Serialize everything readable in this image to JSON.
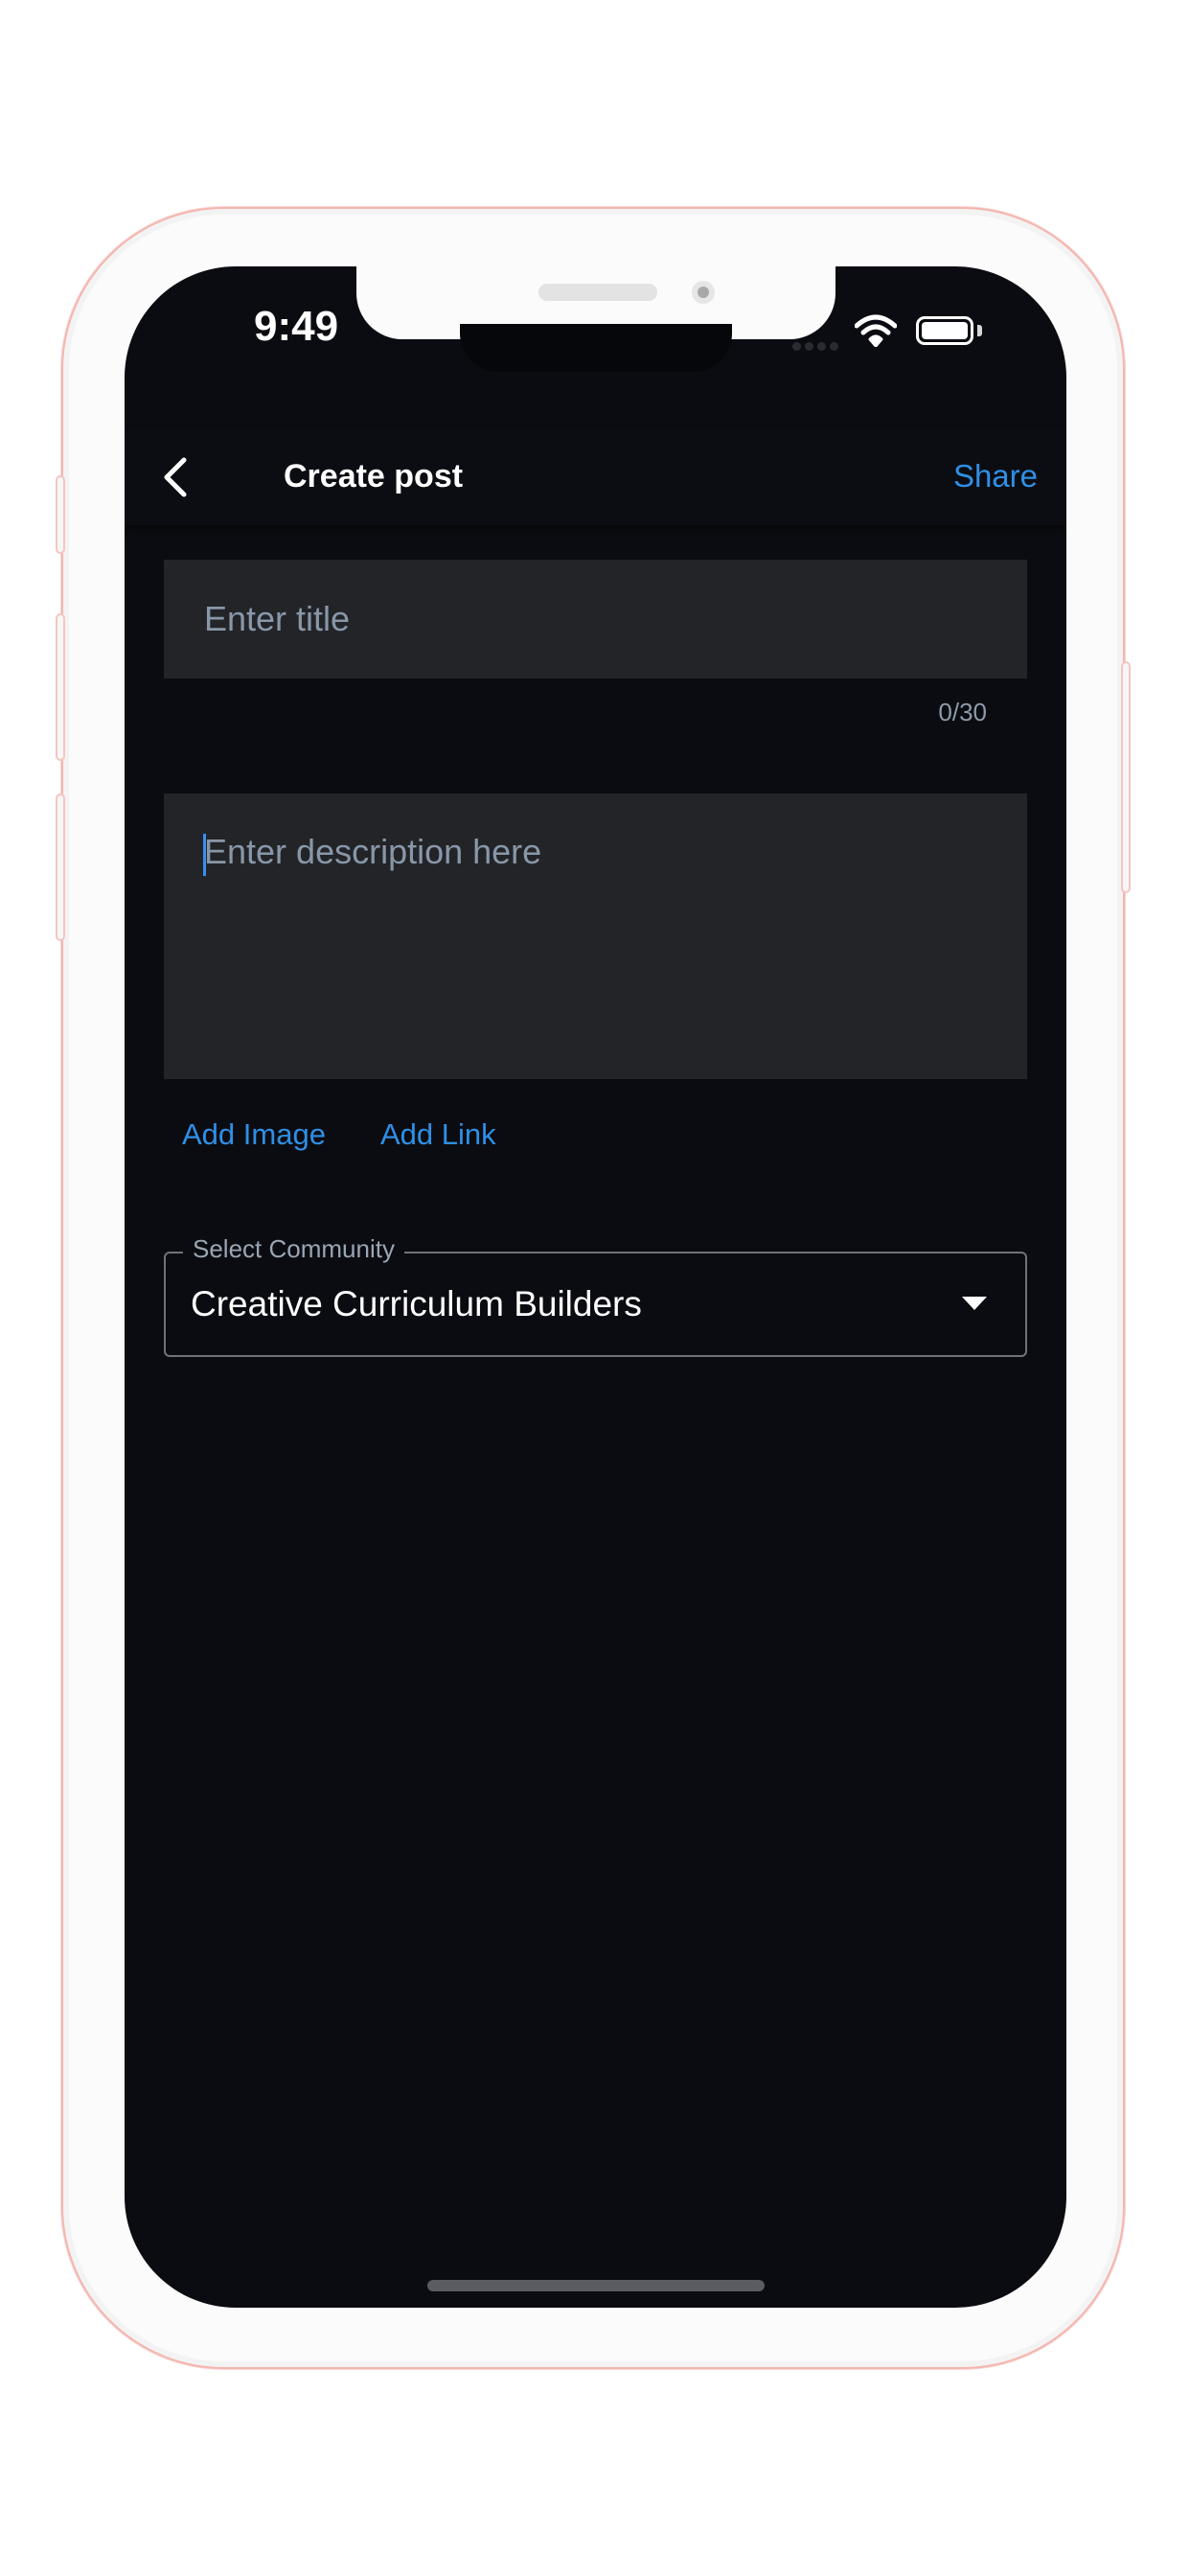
{
  "status_bar": {
    "time": "9:49"
  },
  "app_bar": {
    "title": "Create post",
    "share_label": "Share"
  },
  "title_field": {
    "placeholder": "Enter title",
    "value": "",
    "counter": "0/30"
  },
  "description_field": {
    "placeholder": "Enter description here",
    "value": ""
  },
  "actions": {
    "add_image": "Add Image",
    "add_link": "Add Link"
  },
  "community_select": {
    "label": "Select Community",
    "selected": "Creative Curriculum Builders"
  },
  "icons": {
    "back": "chevron-left-icon",
    "dropdown": "caret-down-icon",
    "wifi": "wifi-icon",
    "battery": "battery-icon"
  },
  "colors": {
    "accent": "#2f8fe6",
    "background": "#0b0c11",
    "field": "#232428"
  }
}
